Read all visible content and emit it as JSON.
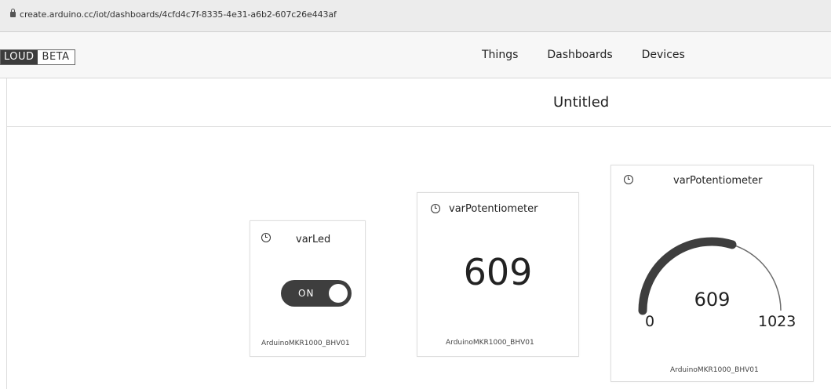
{
  "browser": {
    "url": "create.arduino.cc/iot/dashboards/4cfd4c7f-8335-4e31-a6b2-607c26e443af"
  },
  "header": {
    "brand": "LOUD",
    "badge": "BETA",
    "nav": [
      "Things",
      "Dashboards",
      "Devices"
    ]
  },
  "dashboard": {
    "title": "Untitled"
  },
  "widgets": {
    "led": {
      "name": "varLed",
      "state_label": "ON",
      "state": true,
      "device": "ArduinoMKR1000_BHV01"
    },
    "value": {
      "name": "varPotentiometer",
      "value": "609",
      "device": "ArduinoMKR1000_BHV01"
    },
    "gauge": {
      "name": "varPotentiometer",
      "value": 609,
      "min": 0,
      "max": 1023,
      "device": "ArduinoMKR1000_BHV01"
    }
  },
  "icons": {
    "lock": "lock-icon",
    "history": "history-icon"
  },
  "colors": {
    "toggle_on": "#3e3e3e",
    "gauge_fill": "#3e3e3e",
    "gauge_track": "#6a6a6a"
  }
}
